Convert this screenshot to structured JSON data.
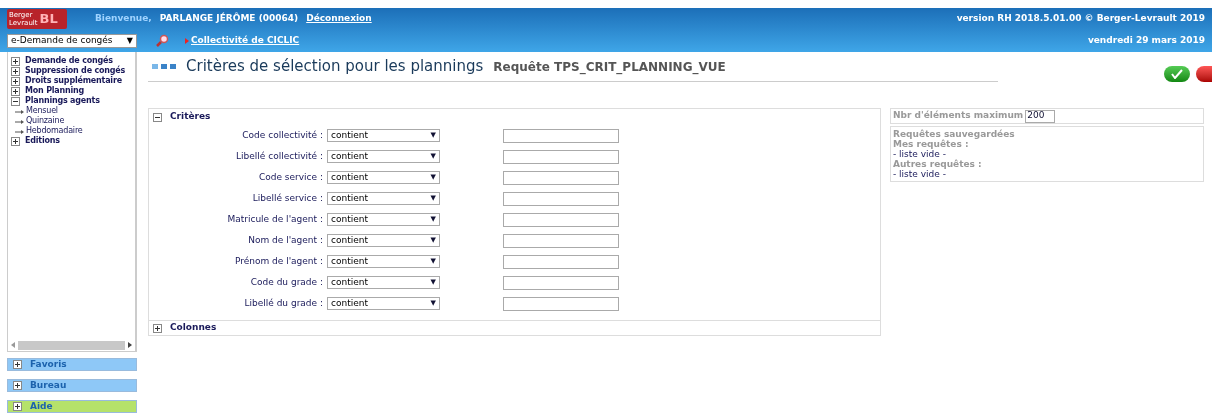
{
  "header": {
    "welcome": "Bienvenue,",
    "user": "PARLANGE JÉRÔME (00064)",
    "logout": "Déconnexion",
    "version": "version RH 2018.5.01.00 © Berger-Levrault 2019",
    "date": "vendredi 29 mars 2019",
    "logo_lines": [
      "Berger",
      "Levrault"
    ],
    "logo_mark": "BL",
    "module_select": "e-Demande de congés",
    "module_arrow": "▼",
    "collectivite": "Collectivité de CICLIC"
  },
  "sidebar": {
    "tree": [
      {
        "label": "Demande de congés",
        "expanded": false
      },
      {
        "label": "Suppression de congés",
        "expanded": false
      },
      {
        "label": "Droits supplémentaire",
        "expanded": false
      },
      {
        "label": "Mon Planning",
        "expanded": false
      },
      {
        "label": "Plannings agents",
        "expanded": true,
        "children": [
          {
            "label": "Mensuel"
          },
          {
            "label": "Quinzaine"
          },
          {
            "label": "Hebdomadaire"
          }
        ]
      },
      {
        "label": "Editions",
        "expanded": false
      }
    ],
    "panels": [
      {
        "label": "Favoris",
        "expanded": false,
        "color": "#8ec8f7"
      },
      {
        "label": "Bureau",
        "expanded": false,
        "color": "#8ec8f7"
      },
      {
        "label": "Aide",
        "expanded": false,
        "color": "#b5e26a"
      }
    ]
  },
  "page": {
    "title": "Critères de sélection pour les plannings",
    "request": "Requête TPS_CRIT_PLANNING_VUE"
  },
  "criteria": {
    "title": "Critères",
    "expanded": true,
    "rows": [
      {
        "label": "Code collectivité :",
        "operator": "contient"
      },
      {
        "label": "Libellé collectivité :",
        "operator": "contient"
      },
      {
        "label": "Code service :",
        "operator": "contient"
      },
      {
        "label": "Libellé service :",
        "operator": "contient"
      },
      {
        "label": "Matricule de l'agent :",
        "operator": "contient"
      },
      {
        "label": "Nom de l'agent :",
        "operator": "contient"
      },
      {
        "label": "Prénom de l'agent :",
        "operator": "contient"
      },
      {
        "label": "Code du grade :",
        "operator": "contient"
      },
      {
        "label": "Libellé du grade :",
        "operator": "contient"
      }
    ],
    "select_arrow": "▼"
  },
  "columns": {
    "title": "Colonnes",
    "expanded": false
  },
  "side": {
    "max_label": "Nbr d'éléments maximum",
    "max_value": "200",
    "saved_title": "Requêtes sauvegardées",
    "mine_label": "Mes requêtes :",
    "mine_empty": "- liste vide -",
    "others_label": "Autres requêtes :",
    "others_empty": "- liste vide -"
  }
}
